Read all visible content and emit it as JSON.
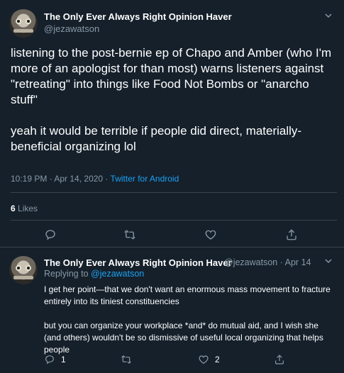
{
  "main_tweet": {
    "author_name": "The Only Ever Always Right Opinion Haver",
    "author_handle": "@jezawatson",
    "text_1": "listening to the post-bernie ep of Chapo and Amber (who I'm more of an apologist for than most) warns listeners against \"retreating\" into things like Food Not Bombs or \"anarcho stuff\"",
    "text_2": "yeah it would be terrible if people did direct, materially-beneficial organizing lol",
    "timestamp": "10:19 PM · Apr 14, 2020 ·",
    "source": "Twitter for Android",
    "likes_count": "6",
    "likes_label": "Likes"
  },
  "reply_tweet": {
    "author_name": "The Only Ever Always Right Opinion Haver",
    "author_handle": "@jezawatson · Apr 14",
    "replying_prefix": "Replying to",
    "replying_handle": "@jezawatson",
    "text_1": "I get her point—that we don't want an enormous mass movement to fracture entirely into its tiniest constituencies",
    "text_2": "but you can organize your workplace *and* do mutual aid, and I wish she (and others) wouldn't be so dismissive of useful local organizing that helps people",
    "reply_count": "1",
    "retweet_count": "",
    "like_count": "2"
  },
  "colors": {
    "background": "#15202b",
    "secondary_text": "#8899a6",
    "link": "#1da1f2",
    "divider": "#38444d"
  }
}
